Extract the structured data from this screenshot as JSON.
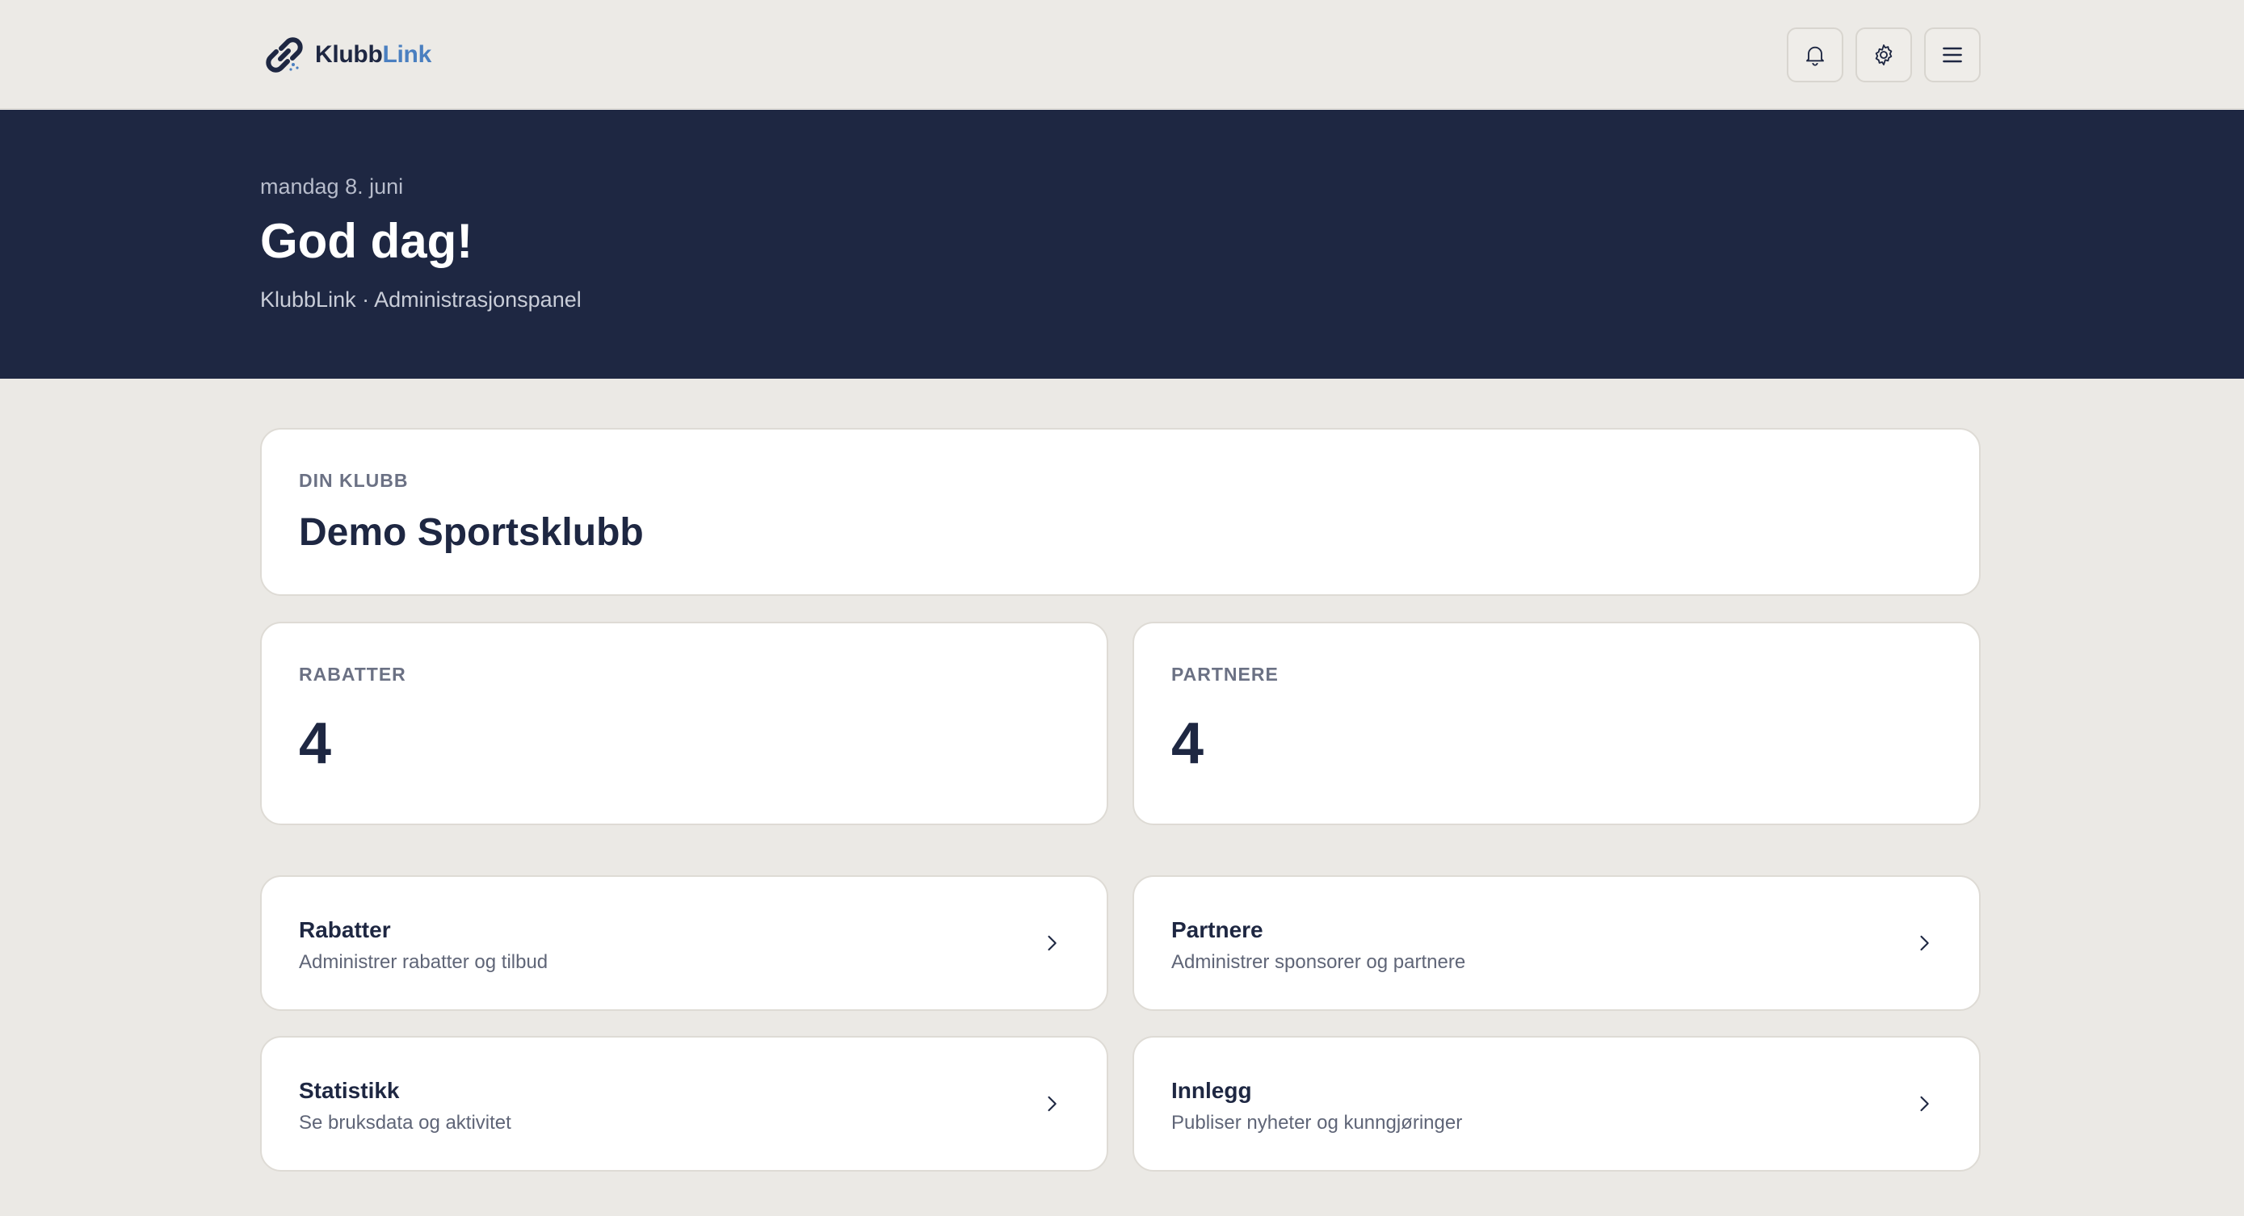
{
  "header": {
    "brand_part1": "Klubb",
    "brand_part2": "Link",
    "icons": [
      "bell-icon",
      "gear-icon",
      "menu-icon"
    ]
  },
  "hero": {
    "date": "mandag 8. juni",
    "greeting": "God dag!",
    "subtitle": "KlubbLink · Administrasjonspanel"
  },
  "club": {
    "label": "DIN KLUBB",
    "name": "Demo Sportsklubb"
  },
  "stats": [
    {
      "label": "RABATTER",
      "value": "4"
    },
    {
      "label": "PARTNERE",
      "value": "4"
    }
  ],
  "nav": [
    {
      "title": "Rabatter",
      "desc": "Administrer rabatter og tilbud"
    },
    {
      "title": "Partnere",
      "desc": "Administrer sponsorer og partnere"
    },
    {
      "title": "Statistikk",
      "desc": "Se bruksdata og aktivitet"
    },
    {
      "title": "Innlegg",
      "desc": "Publiser nyheter og kunngjøringer"
    }
  ],
  "colors": {
    "navy": "#1e2742",
    "accent": "#4a7fc0",
    "background": "#ebe9e5",
    "card": "#ffffff"
  }
}
